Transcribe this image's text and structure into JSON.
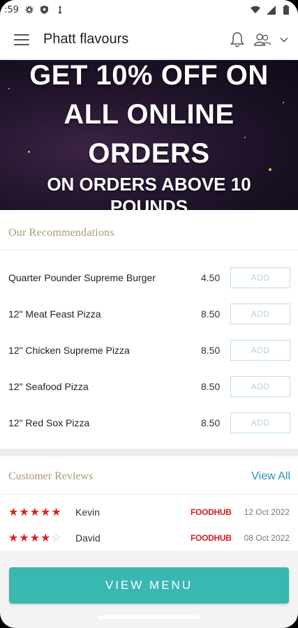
{
  "status_bar": {
    "time": ":59"
  },
  "header": {
    "title": "Phatt flavours"
  },
  "banner": {
    "lines": [
      "GET 10% OFF ON",
      "ALL ONLINE",
      "ORDERS"
    ],
    "sub_line1": "ON ORDERS ABOVE 10",
    "sub_line2": "POUNDS"
  },
  "recommendations": {
    "title": "Our Recommendations",
    "items": [
      {
        "name": "Quarter Pounder Supreme Burger",
        "price": "4.50",
        "button": "ADD"
      },
      {
        "name": "12\" Meat Feast Pizza",
        "price": "8.50",
        "button": "ADD"
      },
      {
        "name": "12\" Chicken Supreme Pizza",
        "price": "8.50",
        "button": "ADD"
      },
      {
        "name": "12\" Seafood Pizza",
        "price": "8.50",
        "button": "ADD"
      },
      {
        "name": "12\" Red Sox Pizza",
        "price": "8.50",
        "button": "ADD"
      }
    ]
  },
  "reviews": {
    "title": "Customer Reviews",
    "view_all": "View All",
    "items": [
      {
        "stars": 5,
        "reviewer": "Kevin",
        "source": "FOODHUB",
        "date": "12 Oct 2022"
      },
      {
        "stars": 4,
        "reviewer": "David",
        "source": "FOODHUB",
        "date": "08 Oct 2022"
      }
    ]
  },
  "view_menu": {
    "label": "VIEW MENU"
  },
  "colors": {
    "accent": "#39b7b1",
    "star": "#e0201f",
    "link": "#2a8fbf",
    "section_title": "#a89979"
  }
}
